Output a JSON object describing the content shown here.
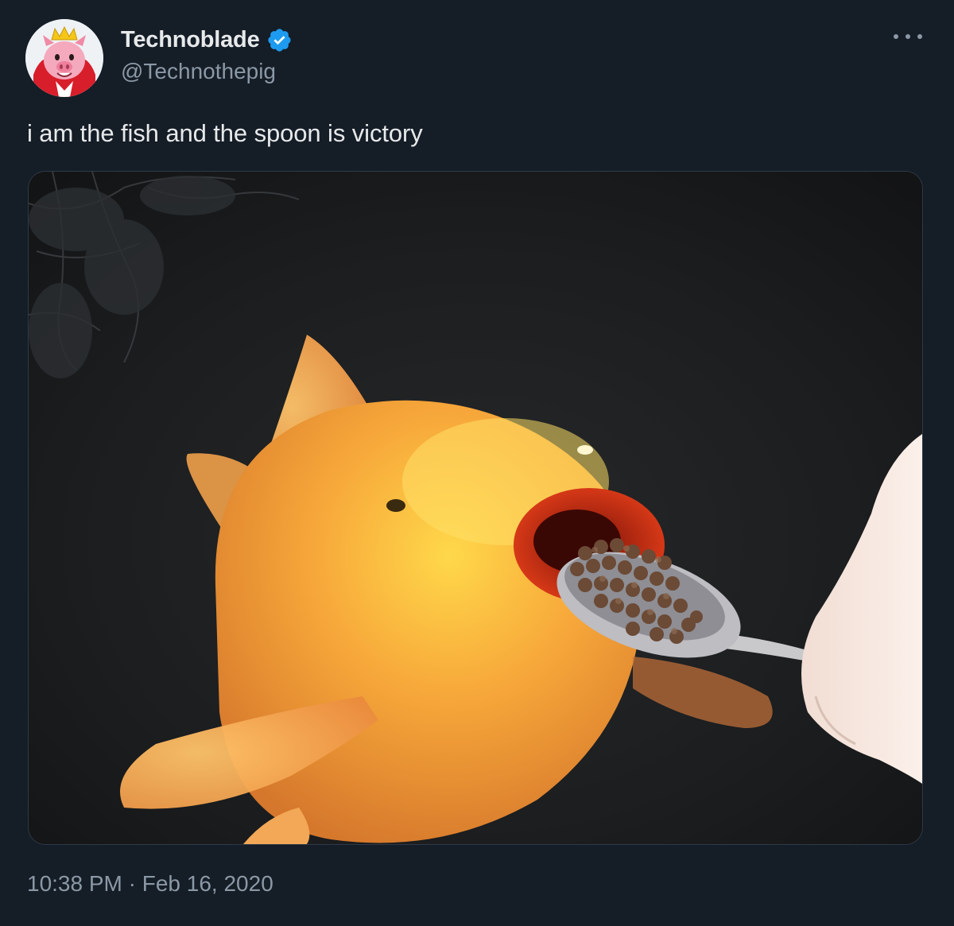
{
  "author": {
    "display_name": "Technoblade",
    "handle": "@Technothepig",
    "verified": true,
    "verified_badge_icon": "verified-badge-icon",
    "avatar_icon": "pig-with-crown-avatar"
  },
  "tweet": {
    "text": "i am the fish and the spoon is victory",
    "media_description_icon": "koi-fish-eating-from-spoon-photo",
    "time": "10:38 PM",
    "separator": "·",
    "date": "Feb 16, 2020"
  },
  "menu": {
    "more_icon": "more-options-icon"
  },
  "colors": {
    "background": "#151d27",
    "primary_text": "#e7e9ea",
    "secondary_text": "#8b98a5",
    "verified_blue": "#1d9bf0"
  }
}
